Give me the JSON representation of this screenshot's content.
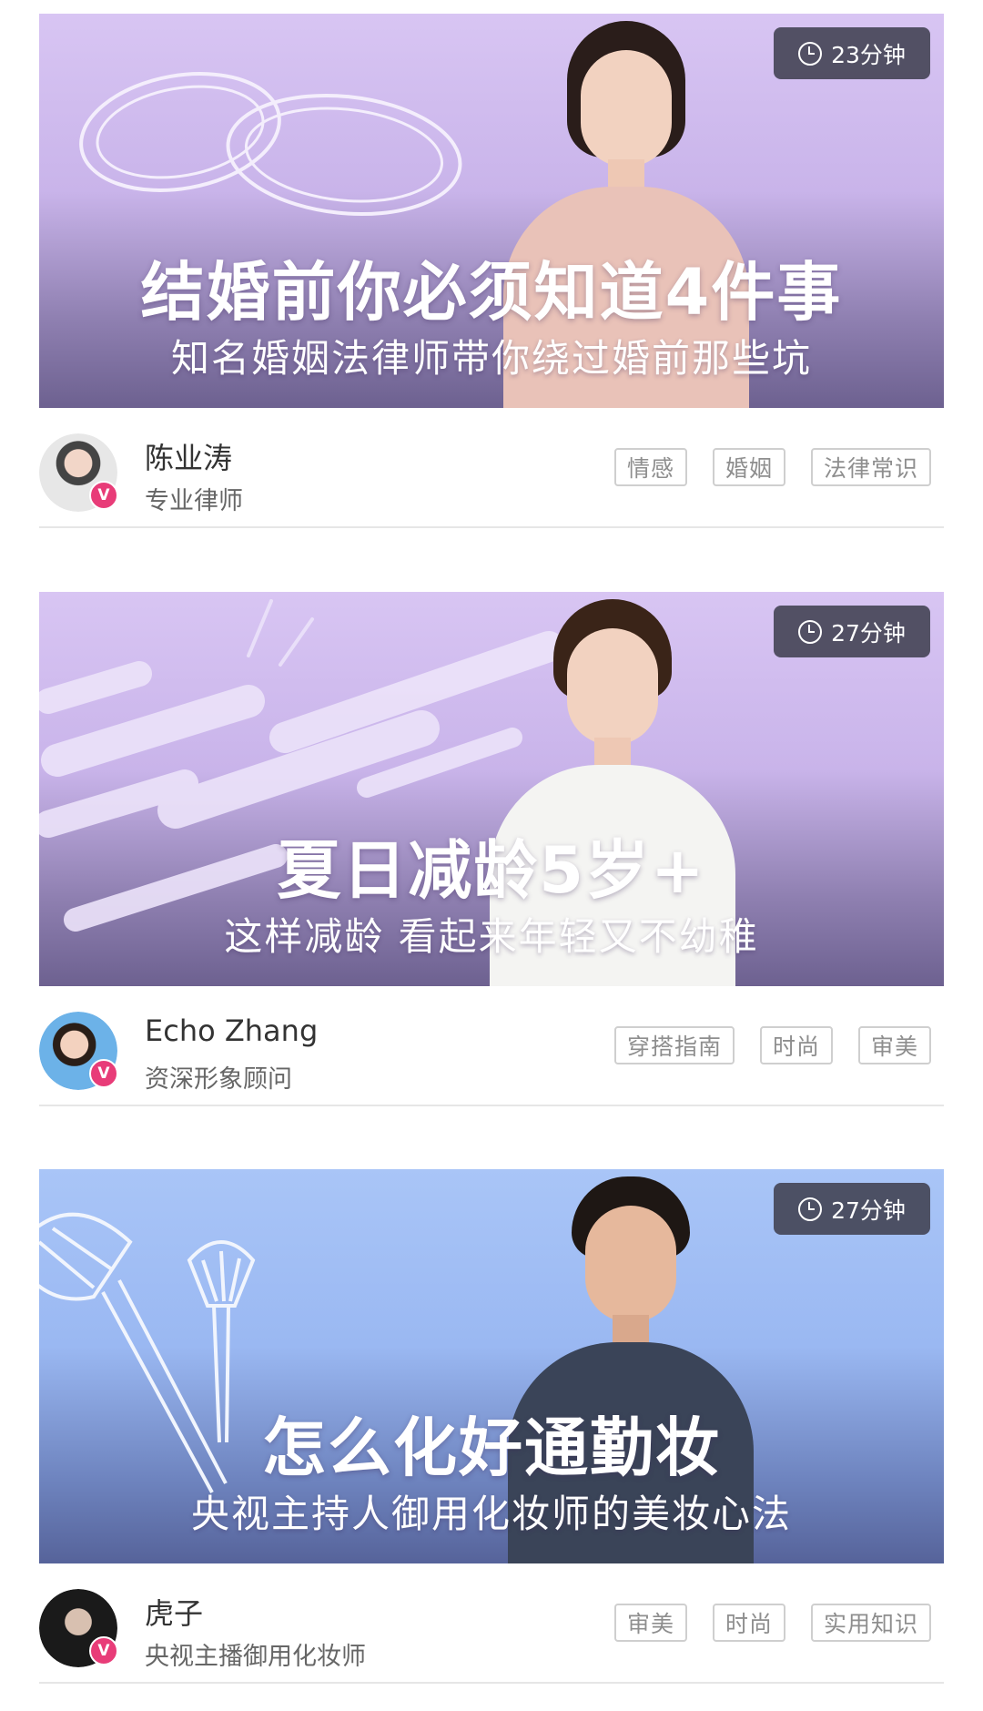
{
  "cards": [
    {
      "duration": "23分钟",
      "title": "结婚前你必须知道4件事",
      "subtitle": "知名婚姻法律师带你绕过婚前那些坑",
      "author": {
        "name": "陈业涛",
        "role": "专业律师",
        "badge": "V"
      },
      "tags": [
        "情感",
        "婚姻",
        "法律常识"
      ]
    },
    {
      "duration": "27分钟",
      "title": "夏日减龄5岁+",
      "subtitle": "这样减龄 看起来年轻又不幼稚",
      "author": {
        "name": "Echo Zhang",
        "role": "资深形象顾问",
        "badge": "V"
      },
      "tags": [
        "穿搭指南",
        "时尚",
        "审美"
      ]
    },
    {
      "duration": "27分钟",
      "title": "怎么化好通勤妆",
      "subtitle": "央视主持人御用化妆师的美妆心法",
      "author": {
        "name": "虎子",
        "role": "央视主播御用化妆师",
        "badge": "V"
      },
      "tags": [
        "审美",
        "时尚",
        "实用知识"
      ]
    }
  ],
  "colors": {
    "purple_banner": "#d8c5f3",
    "blue_banner": "#a9c5f7",
    "duration_badge": "#404050",
    "verified_badge": "#e83c78",
    "tag_text": "#8e8e8e"
  },
  "icons": {
    "duration": "clock-icon",
    "verified": "verified-v-badge-icon"
  }
}
